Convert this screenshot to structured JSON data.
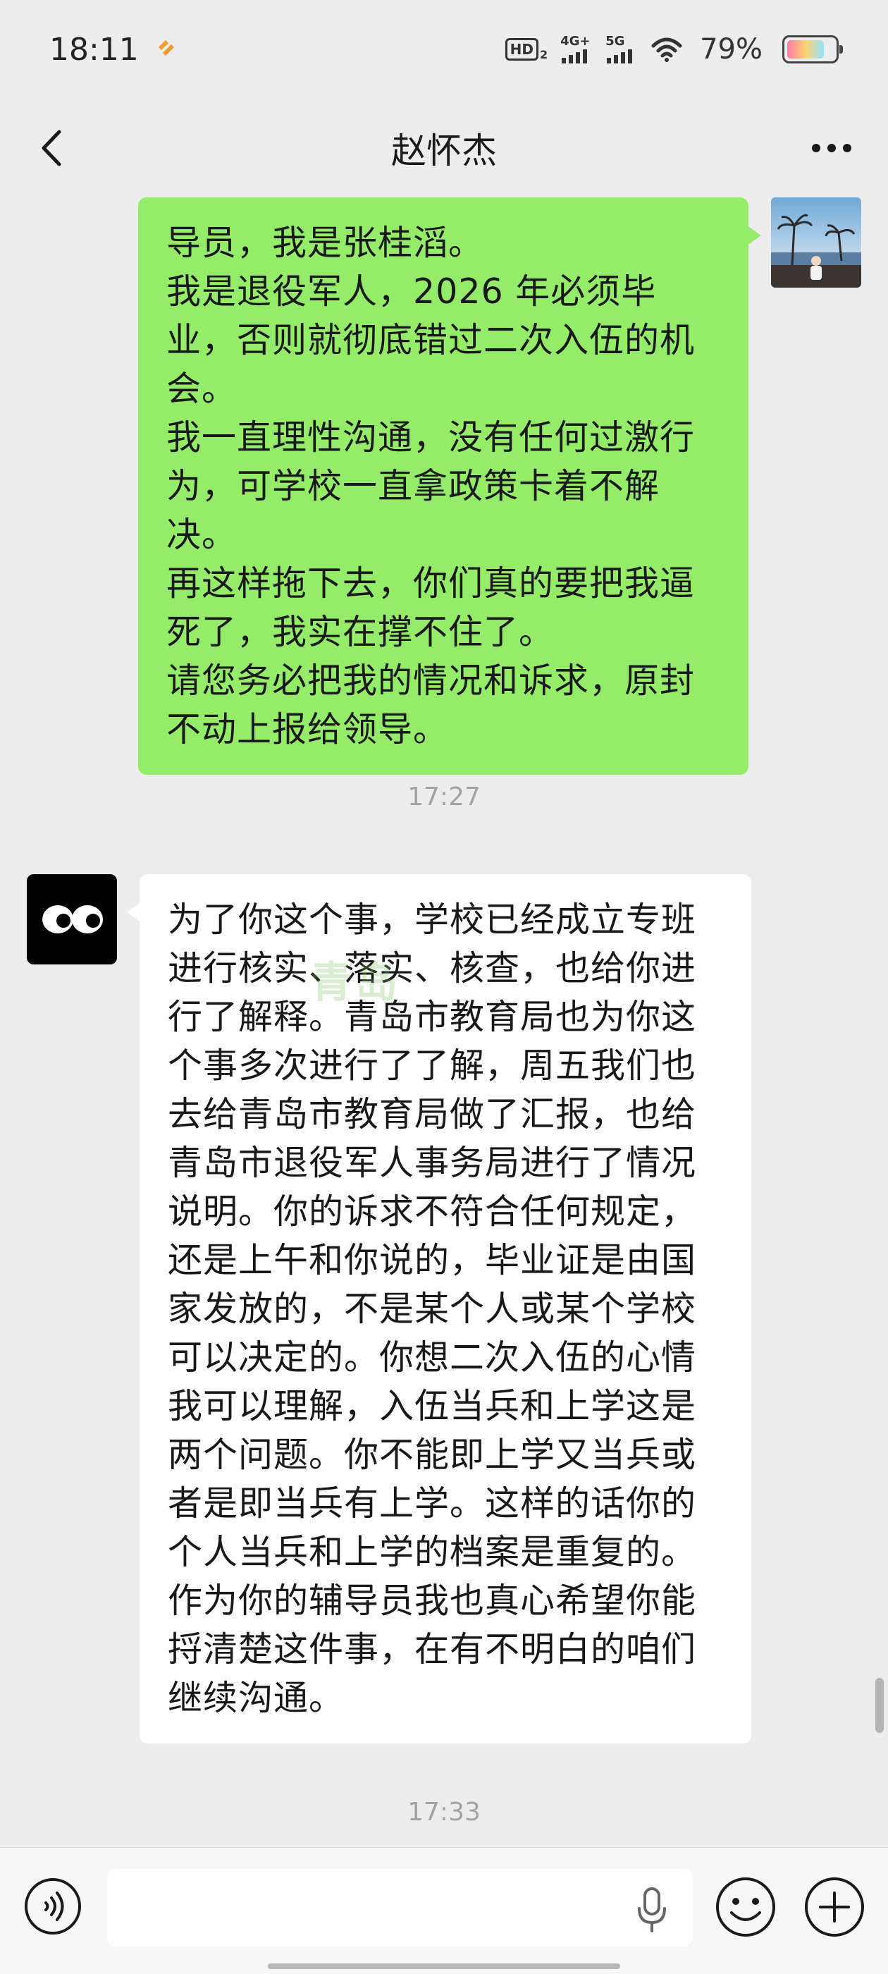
{
  "status_bar": {
    "time": "18:11",
    "hd_label": "HD",
    "hd_sub": "2",
    "net1": "4G+",
    "net2": "5G",
    "battery_pct": "79%",
    "battery_level": 0.79
  },
  "nav": {
    "title": "赵怀杰"
  },
  "messages": {
    "outgoing": {
      "lines": [
        "导员，我是张桂滔。",
        "我是退役军人，2026 年必须毕业，否则就彻底错过二次入伍的机会。",
        "我一直理性沟通，没有任何过激行为，可学校一直拿政策卡着不解决。",
        "再这样拖下去，你们真的要把我逼死了，我实在撑不住了。",
        "请您务必把我的情况和诉求，原封不动上报给领导。"
      ]
    },
    "timestamp1": "17:27",
    "incoming": {
      "text": "为了你这个事，学校已经成立专班进行核实、落实、核查，也给你进行了解释。青岛市教育局也为你这个事多次进行了了解，周五我们也去给青岛市教育局做了汇报，也给青岛市退役军人事务局进行了情况说明。你的诉求不符合任何规定，还是上午和你说的，毕业证是由国家发放的，不是某个人或某个学校可以决定的。你想二次入伍的心情我可以理解，入伍当兵和上学这是两个问题。你不能即上学又当兵或者是即当兵有上学。这样的话你的个人当兵和上学的档案是重复的。作为你的辅导员我也真心希望你能捋清楚这件事，在有不明白的咱们继续沟通。"
    },
    "timestamp2": "17:33"
  },
  "watermark": "青岛",
  "input": {
    "value": "",
    "placeholder": ""
  },
  "icons": {
    "back": "chevron-left-icon",
    "more": "more-dots-icon",
    "voice": "voice-mode-icon",
    "mic": "microphone-icon",
    "emoji": "emoji-icon",
    "plus": "plus-icon"
  },
  "colors": {
    "outgoing_bubble": "#95ec69",
    "incoming_bubble": "#ffffff",
    "background": "#ededed"
  }
}
